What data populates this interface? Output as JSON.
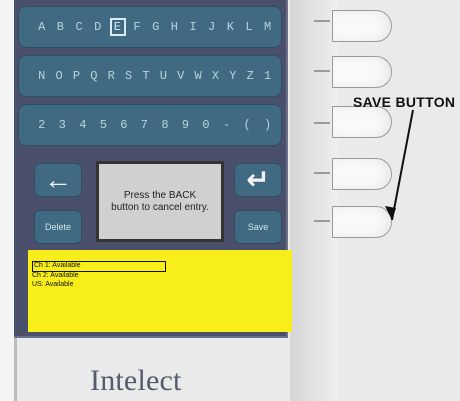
{
  "keyboard": {
    "rows": [
      [
        "A",
        "B",
        "C",
        "D",
        "E",
        "F",
        "G",
        "H",
        "I",
        "J",
        "K",
        "L",
        "M"
      ],
      [
        "N",
        "O",
        "P",
        "Q",
        "R",
        "S",
        "T",
        "U",
        "V",
        "W",
        "X",
        "Y",
        "Z",
        "1"
      ],
      [
        "2",
        "3",
        "4",
        "5",
        "6",
        "7",
        "8",
        "9",
        "0",
        "-",
        "(",
        ")"
      ]
    ],
    "selected_key": "E"
  },
  "buttons": {
    "back_symbol": "←",
    "enter_symbol": "↵",
    "delete_label": "Delete",
    "save_label": "Save"
  },
  "message": "Press the BACK button to cancel entry.",
  "status": {
    "lines": [
      "Ch 1:  Available",
      "Ch 2:  Available",
      "US:    Available"
    ]
  },
  "callout": {
    "label": "SAVE BUTTON"
  },
  "brand": {
    "name": "Intelect"
  }
}
